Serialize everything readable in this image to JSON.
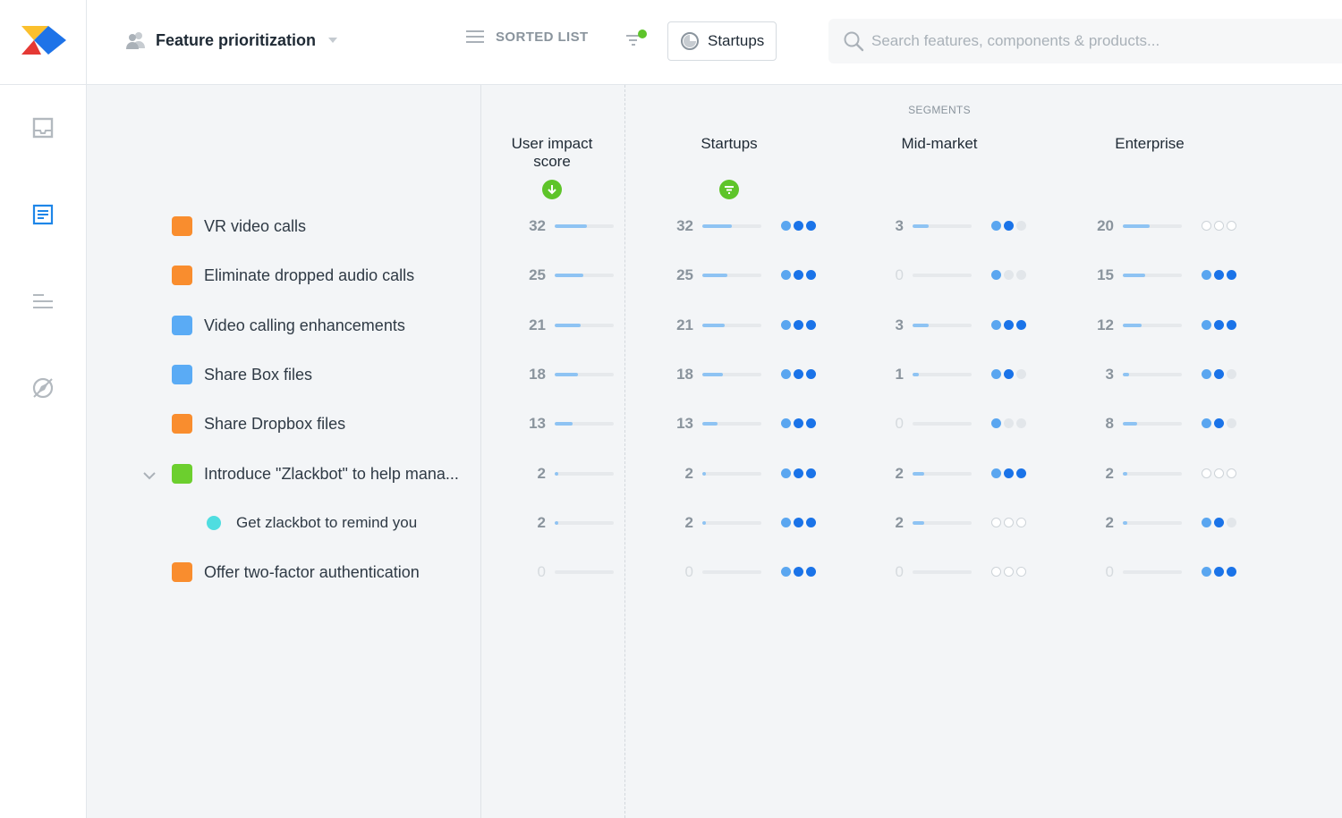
{
  "header": {
    "title": "Feature prioritization",
    "view_label": "SORTED LIST",
    "segment_button": "Startups",
    "search_placeholder": "Search features, components & products..."
  },
  "columns": {
    "segments_label": "SEGMENTS",
    "impact": "User impact score",
    "startups": "Startups",
    "midmarket": "Mid-market",
    "enterprise": "Enterprise"
  },
  "colors": {
    "orange": "#f98d2e",
    "blue": "#5aabf5",
    "green": "#6ccf2e",
    "teal": "#4fdde0",
    "accent": "#1a73e8"
  },
  "features": [
    {
      "name": "VR video calls",
      "color": "#f98d2e",
      "child": false,
      "expandable": false,
      "impact": {
        "value": 32,
        "fill": 0.55
      },
      "startups": {
        "value": 32,
        "fill": 0.5,
        "dots": 3
      },
      "midmarket": {
        "value": 3,
        "fill": 0.28,
        "dots": 2
      },
      "enterprise": {
        "value": 20,
        "fill": 0.45,
        "dots": 0
      }
    },
    {
      "name": "Eliminate dropped audio calls",
      "color": "#f98d2e",
      "child": false,
      "expandable": false,
      "impact": {
        "value": 25,
        "fill": 0.48
      },
      "startups": {
        "value": 25,
        "fill": 0.42,
        "dots": 3
      },
      "midmarket": {
        "value": 0,
        "fill": 0,
        "dots": 1
      },
      "enterprise": {
        "value": 15,
        "fill": 0.38,
        "dots": 3
      }
    },
    {
      "name": "Video calling enhancements",
      "color": "#5aabf5",
      "child": false,
      "expandable": false,
      "impact": {
        "value": 21,
        "fill": 0.44
      },
      "startups": {
        "value": 21,
        "fill": 0.38,
        "dots": 3
      },
      "midmarket": {
        "value": 3,
        "fill": 0.28,
        "dots": 3
      },
      "enterprise": {
        "value": 12,
        "fill": 0.32,
        "dots": 3
      }
    },
    {
      "name": "Share Box files",
      "color": "#5aabf5",
      "child": false,
      "expandable": false,
      "impact": {
        "value": 18,
        "fill": 0.4
      },
      "startups": {
        "value": 18,
        "fill": 0.35,
        "dots": 3
      },
      "midmarket": {
        "value": 1,
        "fill": 0.1,
        "dots": 2
      },
      "enterprise": {
        "value": 3,
        "fill": 0.1,
        "dots": 2
      }
    },
    {
      "name": "Share Dropbox files",
      "color": "#f98d2e",
      "child": false,
      "expandable": false,
      "impact": {
        "value": 13,
        "fill": 0.3
      },
      "startups": {
        "value": 13,
        "fill": 0.26,
        "dots": 3
      },
      "midmarket": {
        "value": 0,
        "fill": 0,
        "dots": 1
      },
      "enterprise": {
        "value": 8,
        "fill": 0.24,
        "dots": 2
      }
    },
    {
      "name": "Introduce \"Zlackbot\" to help mana...",
      "color": "#6ccf2e",
      "child": false,
      "expandable": true,
      "impact": {
        "value": 2,
        "fill": 0.06
      },
      "startups": {
        "value": 2,
        "fill": 0.06,
        "dots": 3
      },
      "midmarket": {
        "value": 2,
        "fill": 0.2,
        "dots": 3
      },
      "enterprise": {
        "value": 2,
        "fill": 0.08,
        "dots": 0
      }
    },
    {
      "name": "Get zlackbot to remind you",
      "color": "#4fdde0",
      "child": true,
      "expandable": false,
      "impact": {
        "value": 2,
        "fill": 0.06
      },
      "startups": {
        "value": 2,
        "fill": 0.06,
        "dots": 3
      },
      "midmarket": {
        "value": 2,
        "fill": 0.2,
        "dots": 0
      },
      "enterprise": {
        "value": 2,
        "fill": 0.08,
        "dots": 2
      }
    },
    {
      "name": "Offer two-factor authentication",
      "color": "#f98d2e",
      "child": false,
      "expandable": false,
      "impact": {
        "value": 0,
        "fill": 0
      },
      "startups": {
        "value": 0,
        "fill": 0,
        "dots": 3
      },
      "midmarket": {
        "value": 0,
        "fill": 0,
        "dots": 0
      },
      "enterprise": {
        "value": 0,
        "fill": 0,
        "dots": 3
      }
    }
  ]
}
